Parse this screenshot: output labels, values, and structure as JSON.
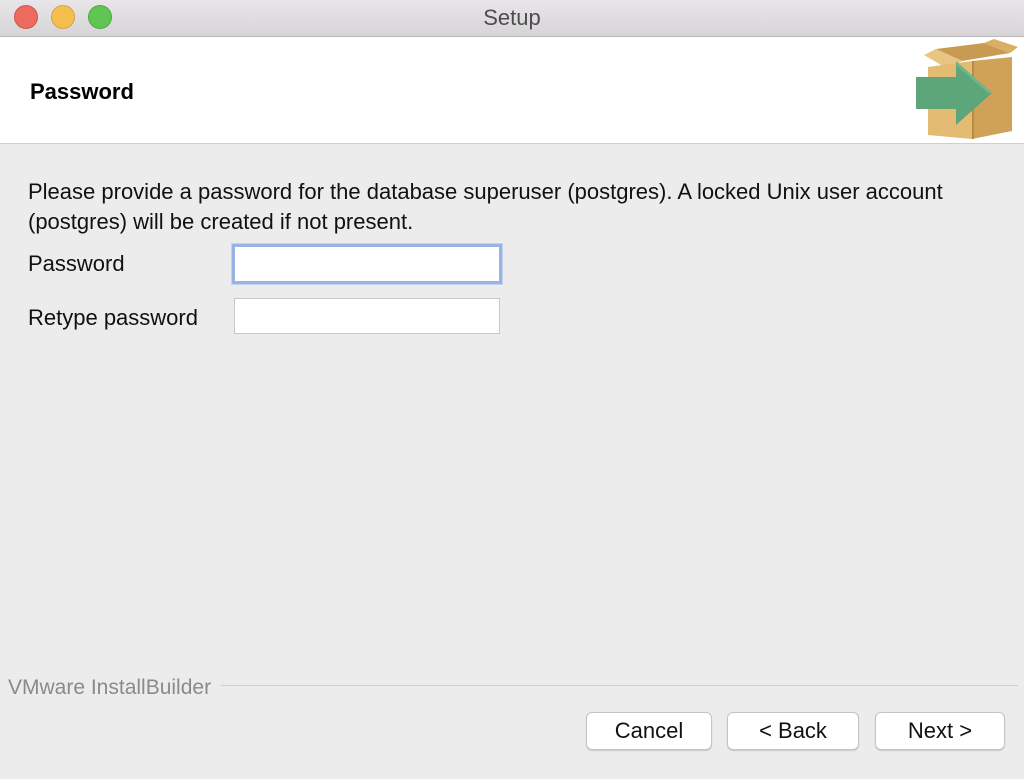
{
  "window": {
    "title": "Setup"
  },
  "header": {
    "title": "Password",
    "icon": "installer-box-arrow-icon"
  },
  "body": {
    "description": "Please provide a password for the database superuser (postgres). A locked Unix user account (postgres) will be created if not present.",
    "fields": [
      {
        "label": "Password",
        "value": "",
        "focused": true
      },
      {
        "label": "Retype password",
        "value": "",
        "focused": false
      }
    ]
  },
  "footer": {
    "brand": "VMware InstallBuilder",
    "buttons": {
      "cancel": "Cancel",
      "back": "< Back",
      "next": "Next >"
    }
  },
  "colors": {
    "focus_ring": "#9bb3e4",
    "box_tan": "#e0b870",
    "arrow_green": "#5da67a"
  }
}
